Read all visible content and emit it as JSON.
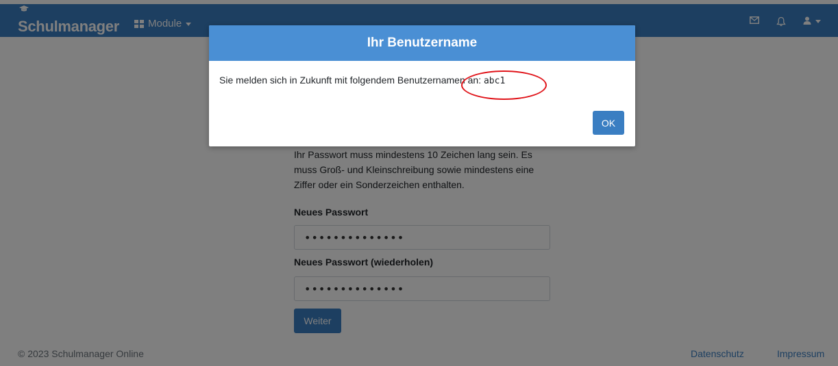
{
  "navbar": {
    "brand": "Schulmanager",
    "module_label": "Module"
  },
  "form": {
    "password_hint": "Ihr Passwort muss mindestens 10 Zeichen lang sein. Es muss Groß- und Kleinschreibung sowie mindestens eine Ziffer oder ein Sonderzeichen enthalten.",
    "new_password_label": "Neues Passwort",
    "new_password_value": "••••••••••••••",
    "repeat_password_label": "Neues Passwort (wiederholen)",
    "repeat_password_value": "••••••••••••••",
    "continue_label": "Weiter"
  },
  "footer": {
    "copyright": "© 2023 Schulmanager Online",
    "privacy_link": "Datenschutz",
    "imprint_link": "Impressum"
  },
  "modal": {
    "title": "Ihr Benutzername",
    "message": "Sie melden sich in Zukunft mit folgendem Benutzernamen an: ",
    "username": "abc1",
    "ok_label": "OK"
  },
  "icons": {
    "brand_cap": "graduation-cap-icon",
    "modules": "grid-icon",
    "mail": "mail-icon",
    "notifications": "bell-icon",
    "user": "user-icon"
  },
  "colors": {
    "primary": "#3a7ec2",
    "modal_header": "#4a8fd4",
    "annotation": "#e0141a"
  }
}
